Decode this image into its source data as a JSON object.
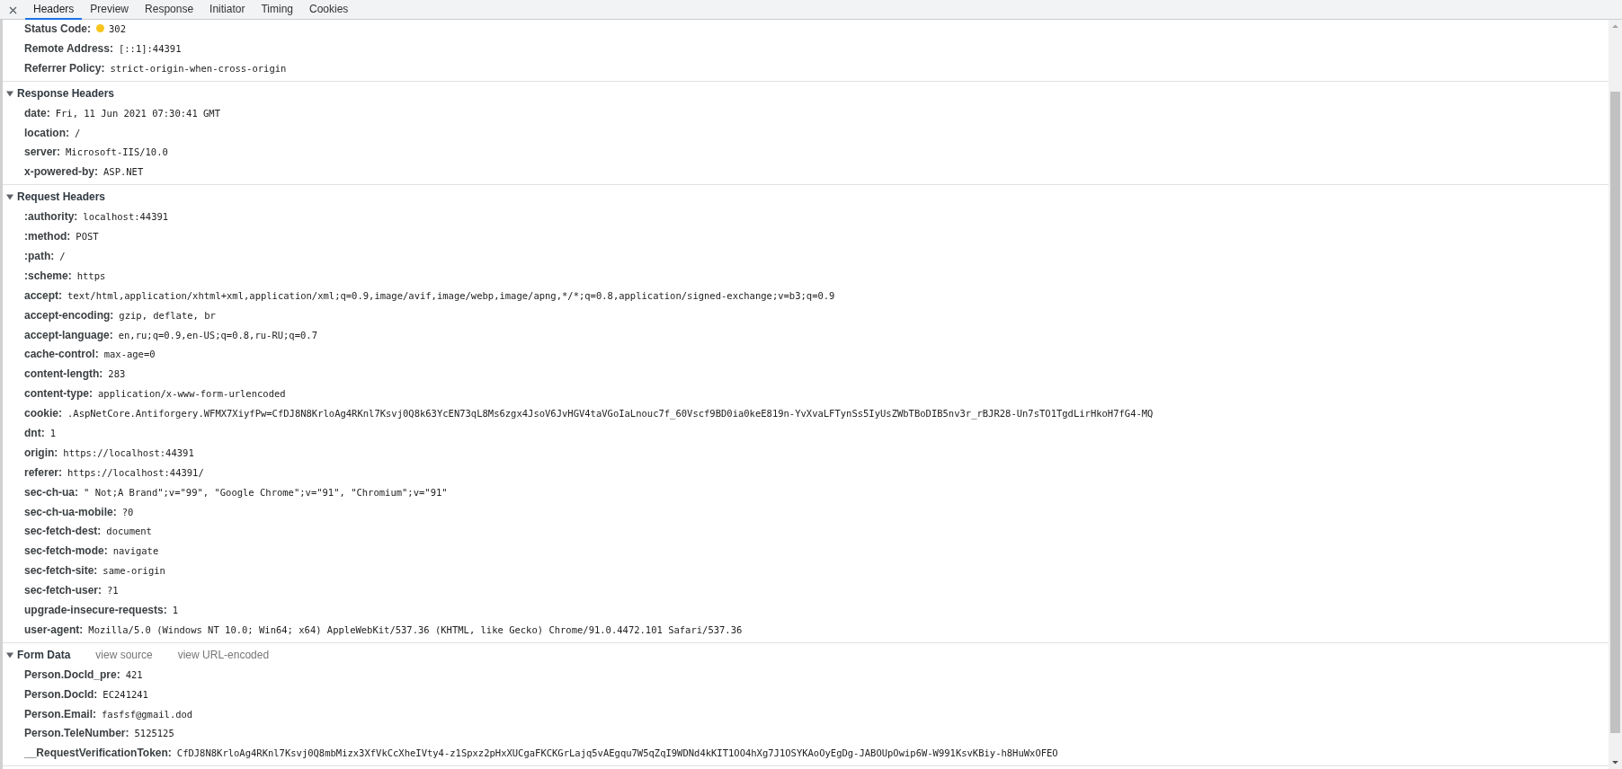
{
  "tabs": [
    {
      "label": "Headers",
      "selected": true
    },
    {
      "label": "Preview",
      "selected": false
    },
    {
      "label": "Response",
      "selected": false
    },
    {
      "label": "Initiator",
      "selected": false
    },
    {
      "label": "Timing",
      "selected": false
    },
    {
      "label": "Cookies",
      "selected": false
    }
  ],
  "general": {
    "rows": [
      {
        "key": "Status Code:",
        "value": "302",
        "color": "#f8c51c"
      },
      {
        "key": "Remote Address:",
        "value": "[::1]:44391"
      },
      {
        "key": "Referrer Policy:",
        "value": "strict-origin-when-cross-origin"
      }
    ]
  },
  "sections": [
    {
      "title": "Response Headers",
      "expanded": true,
      "rows": [
        {
          "key": "date:",
          "value": "Fri, 11 Jun 2021 07:30:41 GMT"
        },
        {
          "key": "location:",
          "value": "/"
        },
        {
          "key": "server:",
          "value": "Microsoft-IIS/10.0"
        },
        {
          "key": "x-powered-by:",
          "value": "ASP.NET"
        }
      ]
    },
    {
      "title": "Request Headers",
      "expanded": true,
      "rows": [
        {
          "key": ":authority:",
          "value": "localhost:44391"
        },
        {
          "key": ":method:",
          "value": "POST"
        },
        {
          "key": ":path:",
          "value": "/"
        },
        {
          "key": ":scheme:",
          "value": "https"
        },
        {
          "key": "accept:",
          "value": "text/html,application/xhtml+xml,application/xml;q=0.9,image/avif,image/webp,image/apng,*/*;q=0.8,application/signed-exchange;v=b3;q=0.9"
        },
        {
          "key": "accept-encoding:",
          "value": "gzip, deflate, br"
        },
        {
          "key": "accept-language:",
          "value": "en,ru;q=0.9,en-US;q=0.8,ru-RU;q=0.7"
        },
        {
          "key": "cache-control:",
          "value": "max-age=0"
        },
        {
          "key": "content-length:",
          "value": "283"
        },
        {
          "key": "content-type:",
          "value": "application/x-www-form-urlencoded"
        },
        {
          "key": "cookie:",
          "value": ".AspNetCore.Antiforgery.WFMX7XiyfPw=CfDJ8N8KrloAg4RKnl7Ksvj0Q8k63YcEN73qL8Ms6zgx4JsoV6JvHGV4taVGoIaLnouc7f_60Vscf9BD0ia0keE819n-YvXvaLFTynSs5IyUsZWbTBoDIB5nv3r_rBJR28-Un7sTO1TgdLirHkoH7fG4-MQ"
        },
        {
          "key": "dnt:",
          "value": "1"
        },
        {
          "key": "origin:",
          "value": "https://localhost:44391"
        },
        {
          "key": "referer:",
          "value": "https://localhost:44391/"
        },
        {
          "key": "sec-ch-ua:",
          "value": "\" Not;A Brand\";v=\"99\", \"Google Chrome\";v=\"91\", \"Chromium\";v=\"91\""
        },
        {
          "key": "sec-ch-ua-mobile:",
          "value": "?0"
        },
        {
          "key": "sec-fetch-dest:",
          "value": "document"
        },
        {
          "key": "sec-fetch-mode:",
          "value": "navigate"
        },
        {
          "key": "sec-fetch-site:",
          "value": "same-origin"
        },
        {
          "key": "sec-fetch-user:",
          "value": "?1"
        },
        {
          "key": "upgrade-insecure-requests:",
          "value": "1"
        },
        {
          "key": "user-agent:",
          "value": "Mozilla/5.0 (Windows NT 10.0; Win64; x64) AppleWebKit/537.36 (KHTML, like Gecko) Chrome/91.0.4472.101 Safari/537.36"
        }
      ]
    },
    {
      "title": "Form Data",
      "expanded": true,
      "links": [
        "view source",
        "view URL-encoded"
      ],
      "rows": [
        {
          "key": "Person.DocId_pre:",
          "value": "421"
        },
        {
          "key": "Person.DocId:",
          "value": "EC241241"
        },
        {
          "key": "Person.Email:",
          "value": "fasfsf@gmail.dod"
        },
        {
          "key": "Person.TeleNumber:",
          "value": "5125125"
        },
        {
          "key": "__RequestVerificationToken:",
          "value": "CfDJ8N8KrloAg4RKnl7Ksvj0Q8mbMizx3XfVkCcXheIVty4-z1Spxz2pHxXUCgaFKCKGrLajq5vAEgqu7W5qZqI9WDNd4kKIT1OO4hXg7J1OSYKAoOyEgDg-JABOUpOwip6W-W991KsvKBiy-h8HuWxOFEO"
        }
      ]
    }
  ]
}
